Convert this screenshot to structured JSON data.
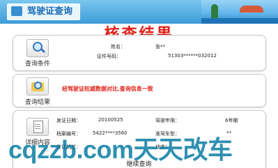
{
  "header": {
    "title": "驾驶证查询"
  },
  "page_title": "核查结果",
  "query_conditions": {
    "button_label": "查询条件",
    "name_label": "姓名：",
    "name_value": "张**",
    "id_label": "证件号码：",
    "id_value": "51303******032012"
  },
  "query_result": {
    "button_label": "查询结果",
    "message": "经驾驶证权威数据对比,查询信息一致"
  },
  "details": {
    "button_label": "详细内容",
    "issue_date_label": "发证日期：",
    "issue_date_value": "20100525",
    "valid_years_label": "驾驶年限：",
    "valid_years_value": "6年期",
    "file_no_label": "档案编号：",
    "file_no_value": "5422****3560",
    "vehicle_type_label": "准驾车型：",
    "vehicle_type_value": "**",
    "issuer_label": "发证机关：",
    "status_label": "状态："
  },
  "continue_label": "继续查询",
  "watermark": "cqzzb.com天天改车"
}
